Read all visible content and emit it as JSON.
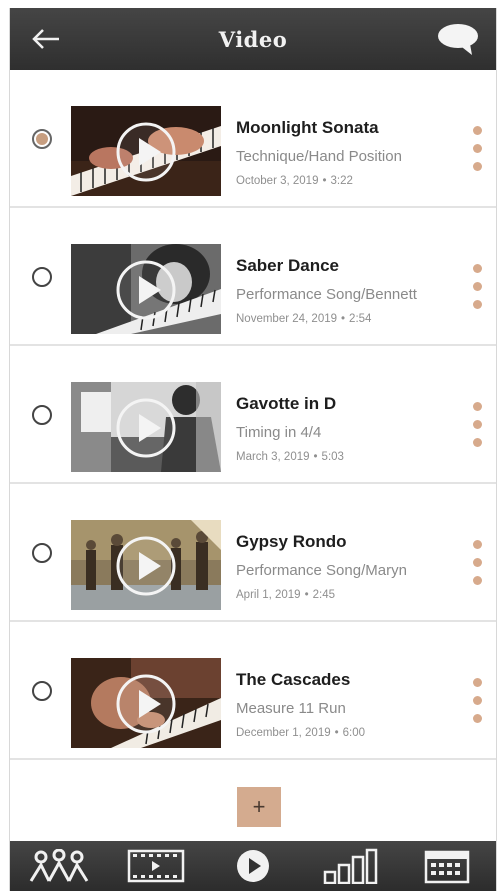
{
  "header": {
    "title": "Video",
    "back_icon": "arrow-left-icon",
    "chat_icon": "speech-bubble-icon"
  },
  "colors": {
    "header_bg": "#3a3a3a",
    "accent": "#d4ab8f",
    "selected_radio": "#c79e80"
  },
  "videos": [
    {
      "title": "Moonlight Sonata",
      "subtitle": "Technique/Hand Position",
      "date": "October 3, 2019",
      "duration": "3:22",
      "selected": true
    },
    {
      "title": "Saber Dance",
      "subtitle": "Performance Song/Bennett",
      "date": "November 24, 2019",
      "duration": "2:54",
      "selected": false
    },
    {
      "title": "Gavotte in D",
      "subtitle": "Timing in 4/4",
      "date": "March 3, 2019",
      "duration": "5:03",
      "selected": false
    },
    {
      "title": "Gypsy Rondo",
      "subtitle": "Performance Song/Maryn",
      "date": "April 1, 2019",
      "duration": "2:45",
      "selected": false
    },
    {
      "title": "The Cascades",
      "subtitle": "Measure 11 Run",
      "date": "December 1, 2019",
      "duration": "6:00",
      "selected": false
    }
  ],
  "add_button": {
    "label": "+"
  },
  "tabbar": [
    {
      "icon": "group-people-icon"
    },
    {
      "icon": "film-strip-icon"
    },
    {
      "icon": "play-circle-icon"
    },
    {
      "icon": "bar-chart-icon"
    },
    {
      "icon": "calendar-icon"
    }
  ],
  "separator": "•"
}
